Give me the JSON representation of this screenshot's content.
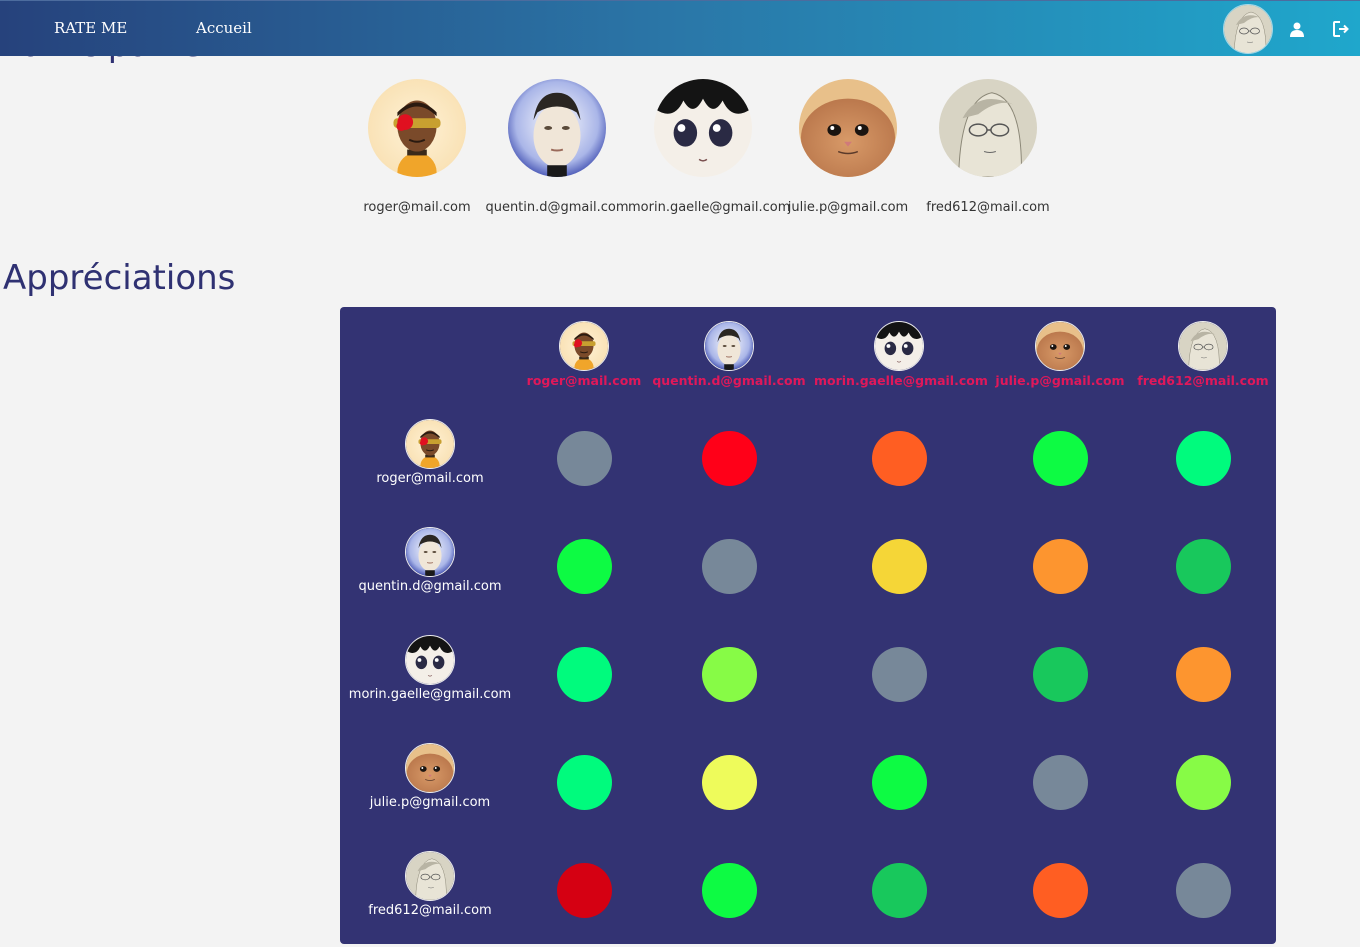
{
  "navbar": {
    "brand": "RATE ME",
    "home_link": "Accueil"
  },
  "participants_section": {
    "title": "Participants",
    "people": [
      {
        "email": "roger@mail.com",
        "avatar": "cartoon-visor"
      },
      {
        "email": "quentin.d@gmail.com",
        "avatar": "android-face"
      },
      {
        "email": "morin.gaelle@gmail.com",
        "avatar": "anime-eyes"
      },
      {
        "email": "julie.p@gmail.com",
        "avatar": "cat-face"
      },
      {
        "email": "fred612@mail.com",
        "avatar": "sketch-glasses"
      }
    ]
  },
  "appreciations_section": {
    "title": "Appréciations",
    "columns": [
      "roger@mail.com",
      "quentin.d@gmail.com",
      "morin.gaelle@gmail.com",
      "julie.p@gmail.com",
      "fred612@mail.com"
    ],
    "rows": [
      "roger@mail.com",
      "quentin.d@gmail.com",
      "morin.gaelle@gmail.com",
      "julie.p@gmail.com",
      "fred612@mail.com"
    ],
    "ratings": [
      [
        "#778899",
        "#ff0018",
        "#ff5e22",
        "#0dfb43",
        "#00fb7d"
      ],
      [
        "#0dfb43",
        "#778899",
        "#f5d637",
        "#fd952f",
        "#18c85c"
      ],
      [
        "#00fb7d",
        "#87fb46",
        "#778899",
        "#18c85c",
        "#fd952f"
      ],
      [
        "#00fb7d",
        "#eefb5b",
        "#0dfb43",
        "#778899",
        "#87fb46"
      ],
      [
        "#d50012",
        "#0dfb43",
        "#18c85c",
        "#ff5e22",
        "#778899"
      ]
    ]
  },
  "colors": {
    "navbar_start": "#26427c",
    "navbar_end": "#1fa7cc",
    "matrix_bg": "#333373",
    "title": "#2f3172",
    "column_email": "#e0185a"
  }
}
